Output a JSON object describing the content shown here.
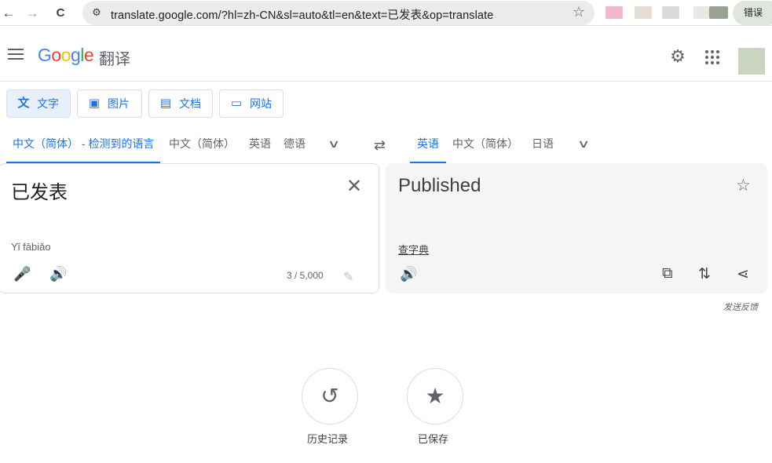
{
  "browser": {
    "back_glyph": "←",
    "forward_glyph": "→",
    "reload_glyph": "C",
    "url": "translate.google.com/?hl=zh-CN&sl=auto&tl=en&text=已发表&op=translate",
    "error_chip": "错误",
    "bookmark_glyph": "☆"
  },
  "header": {
    "logo": {
      "g1": "G",
      "o1": "o",
      "o2": "o",
      "g2": "g",
      "l": "l",
      "e": "e"
    },
    "product_name": "翻译",
    "settings_glyph": "⚙"
  },
  "modes": [
    {
      "label": "文字",
      "icon": "translate-icon",
      "glyph": "文"
    },
    {
      "label": "图片",
      "icon": "image-icon",
      "glyph": "▣"
    },
    {
      "label": "文档",
      "icon": "document-icon",
      "glyph": "▤"
    },
    {
      "label": "网站",
      "icon": "website-icon",
      "glyph": "▭"
    }
  ],
  "source_langs": [
    "中文（简体） - 检测到的语言",
    "中文（简体）",
    "英语",
    "德语"
  ],
  "target_langs": [
    "英语",
    "中文（简体）",
    "日语"
  ],
  "glyphs": {
    "chevron": "∨",
    "swap": "⇄",
    "clear": "✕",
    "mic": "🎤",
    "speaker": "🔊",
    "pencil": "✎",
    "star": "☆",
    "copy": "⧉",
    "rate": "⇅",
    "share": "⋖",
    "history": "↺",
    "saved": "★"
  },
  "source": {
    "text": "已发表",
    "pinyin": "Yǐ fābiǎo",
    "char_count": "3 / 5,000"
  },
  "target": {
    "text": "Published",
    "dictionary_link": "查字典"
  },
  "feedback": "发送反馈",
  "bottom": {
    "history_label": "历史记录",
    "saved_label": "已保存"
  },
  "colors": {
    "accent": "#1a73e8",
    "panel_bg": "#f5f5f5"
  }
}
